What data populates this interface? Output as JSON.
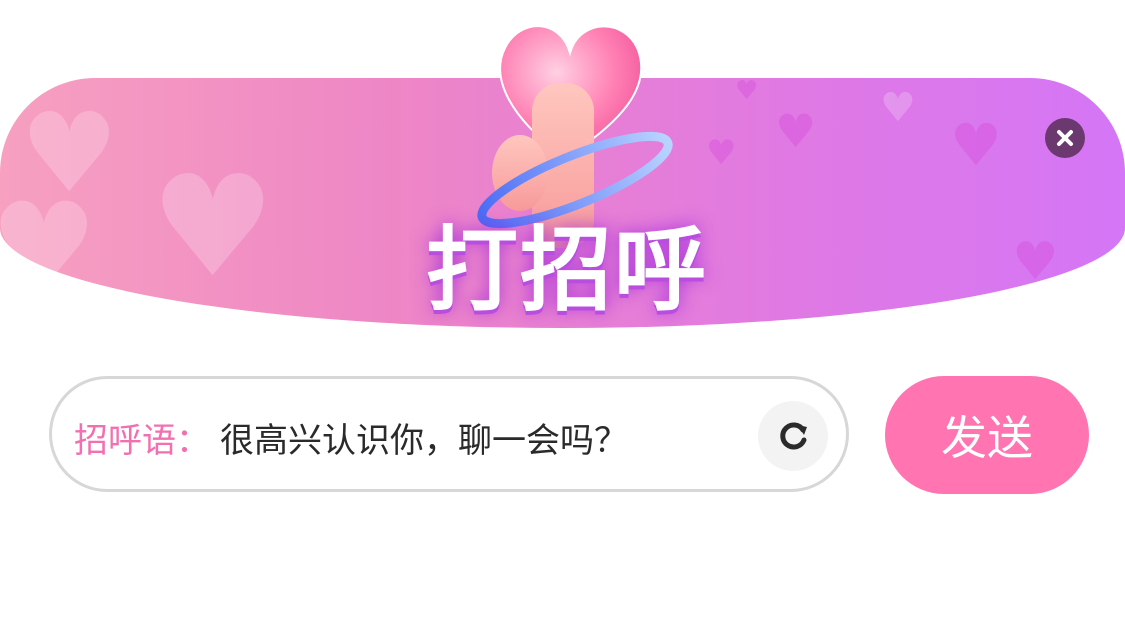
{
  "dialog": {
    "title": "打招呼",
    "close_icon": "close-icon"
  },
  "greeting": {
    "label": "招呼语：",
    "text": "很高兴认识你，聊一会吗？",
    "refresh_icon": "refresh-icon"
  },
  "actions": {
    "send_label": "发送"
  },
  "colors": {
    "accent_pink": "#ff74b1",
    "label_pink": "#f26fb0",
    "banner_start": "#f7a0c0",
    "banner_end": "#d476f6",
    "close_bg": "#6b3870"
  }
}
